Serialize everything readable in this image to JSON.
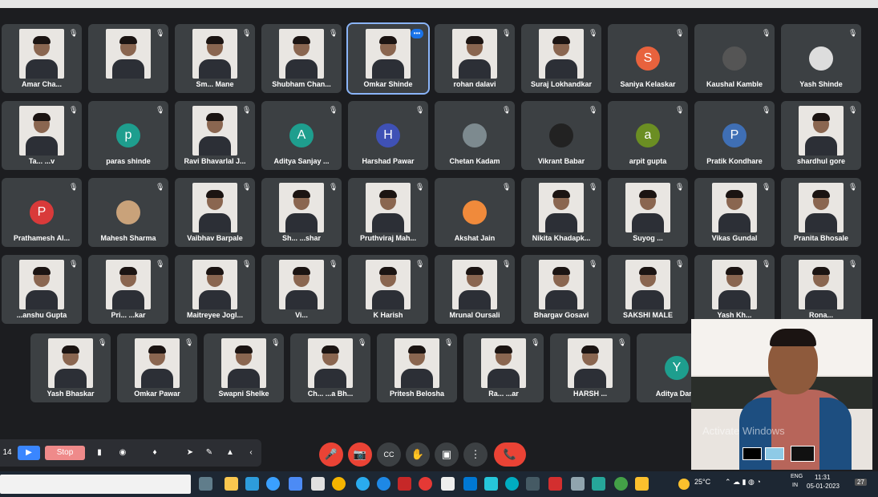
{
  "participants_rows": [
    [
      {
        "name": "Amar Cha...",
        "kind": "photo"
      },
      {
        "name": "",
        "kind": "photo"
      },
      {
        "name": "Sm... Mane",
        "kind": "photo"
      },
      {
        "name": "Shubham Chan...",
        "kind": "photo"
      },
      {
        "name": "Omkar Shinde",
        "kind": "photo",
        "active": true
      },
      {
        "name": "rohan dalavi",
        "kind": "photo"
      },
      {
        "name": "Suraj Lokhandkar",
        "kind": "photo"
      },
      {
        "name": "Saniya Kelaskar",
        "kind": "avatar",
        "letter": "S",
        "color": "#e8623d"
      },
      {
        "name": "Kaushal Kamble",
        "kind": "avatar",
        "letter": "",
        "color": "#555"
      },
      {
        "name": "Yash Shinde",
        "kind": "avatar",
        "letter": "",
        "color": "#ddd"
      }
    ],
    [
      {
        "name": "Ta... ...v",
        "kind": "photo"
      },
      {
        "name": "paras shinde",
        "kind": "avatar",
        "letter": "p",
        "color": "#1e9e8e"
      },
      {
        "name": "Ravi Bhavarlal J...",
        "kind": "photo"
      },
      {
        "name": "Aditya Sanjay ...",
        "kind": "avatar",
        "letter": "A",
        "color": "#1e9e8e"
      },
      {
        "name": "Harshad Pawar",
        "kind": "avatar",
        "letter": "H",
        "color": "#3f51b5"
      },
      {
        "name": "Chetan Kadam",
        "kind": "avatar",
        "letter": "",
        "color": "#7d8a8f"
      },
      {
        "name": "Vikrant Babar",
        "kind": "avatar",
        "letter": "",
        "color": "#222"
      },
      {
        "name": "arpit gupta",
        "kind": "avatar",
        "letter": "a",
        "color": "#6b8e23"
      },
      {
        "name": "Pratik Kondhare",
        "kind": "avatar",
        "letter": "P",
        "color": "#3f6fb5"
      },
      {
        "name": "shardhul gore",
        "kind": "photo"
      }
    ],
    [
      {
        "name": "Prathamesh Al...",
        "kind": "avatar",
        "letter": "P",
        "color": "#d93a3a"
      },
      {
        "name": "Mahesh Sharma",
        "kind": "avatar",
        "letter": "",
        "color": "#c9a27a"
      },
      {
        "name": "Vaibhav Barpale",
        "kind": "photo"
      },
      {
        "name": "Sh... ...shar",
        "kind": "photo"
      },
      {
        "name": "Pruthviraj Mah...",
        "kind": "photo"
      },
      {
        "name": "Akshat Jain",
        "kind": "avatar",
        "letter": "",
        "color": "#f08a3b"
      },
      {
        "name": "Nikita Khadapk...",
        "kind": "photo"
      },
      {
        "name": "Suyog ...",
        "kind": "photo"
      },
      {
        "name": "Vikas Gundal",
        "kind": "photo"
      },
      {
        "name": "Pranita Bhosale",
        "kind": "photo"
      }
    ],
    [
      {
        "name": "...anshu Gupta",
        "kind": "photo"
      },
      {
        "name": "Pri... ...kar",
        "kind": "photo"
      },
      {
        "name": "Maitreyee Jogl...",
        "kind": "photo"
      },
      {
        "name": "Vi...",
        "kind": "photo"
      },
      {
        "name": "K Harish",
        "kind": "photo"
      },
      {
        "name": "Mrunal Oursali",
        "kind": "photo"
      },
      {
        "name": "Bhargav Gosavi",
        "kind": "photo"
      },
      {
        "name": "SAKSHI MALE",
        "kind": "photo"
      },
      {
        "name": "Yash Kh...",
        "kind": "photo"
      },
      {
        "name": "Rona...",
        "kind": "photo"
      }
    ],
    [
      {
        "name": "Yash Bhaskar",
        "kind": "photo"
      },
      {
        "name": "Omkar Pawar",
        "kind": "photo"
      },
      {
        "name": "Swapni Shelke",
        "kind": "photo"
      },
      {
        "name": "Ch... ...a Bh...",
        "kind": "photo"
      },
      {
        "name": "Pritesh Belosha",
        "kind": "photo"
      },
      {
        "name": "Ra... ...ar",
        "kind": "photo"
      },
      {
        "name": "HARSH ...",
        "kind": "photo"
      },
      {
        "name": "Aditya Danti",
        "kind": "avatar",
        "letter": "Y",
        "color": "#1e9e8e"
      }
    ]
  ],
  "self_view": {
    "watermark": "Activate Windows"
  },
  "toolbar_left": {
    "counter": "14",
    "stop_label": "Stop"
  },
  "meet_controls": {
    "mic": "🎤",
    "camera": "📷",
    "captions": "CC",
    "hand": "✋",
    "present": "▣",
    "more": "⋮",
    "end": "📞"
  },
  "taskbar": {
    "weather": "25°C",
    "lang": "ENG",
    "region": "IN",
    "time": "11:31",
    "date": "05-01-2023",
    "notif": "27"
  }
}
